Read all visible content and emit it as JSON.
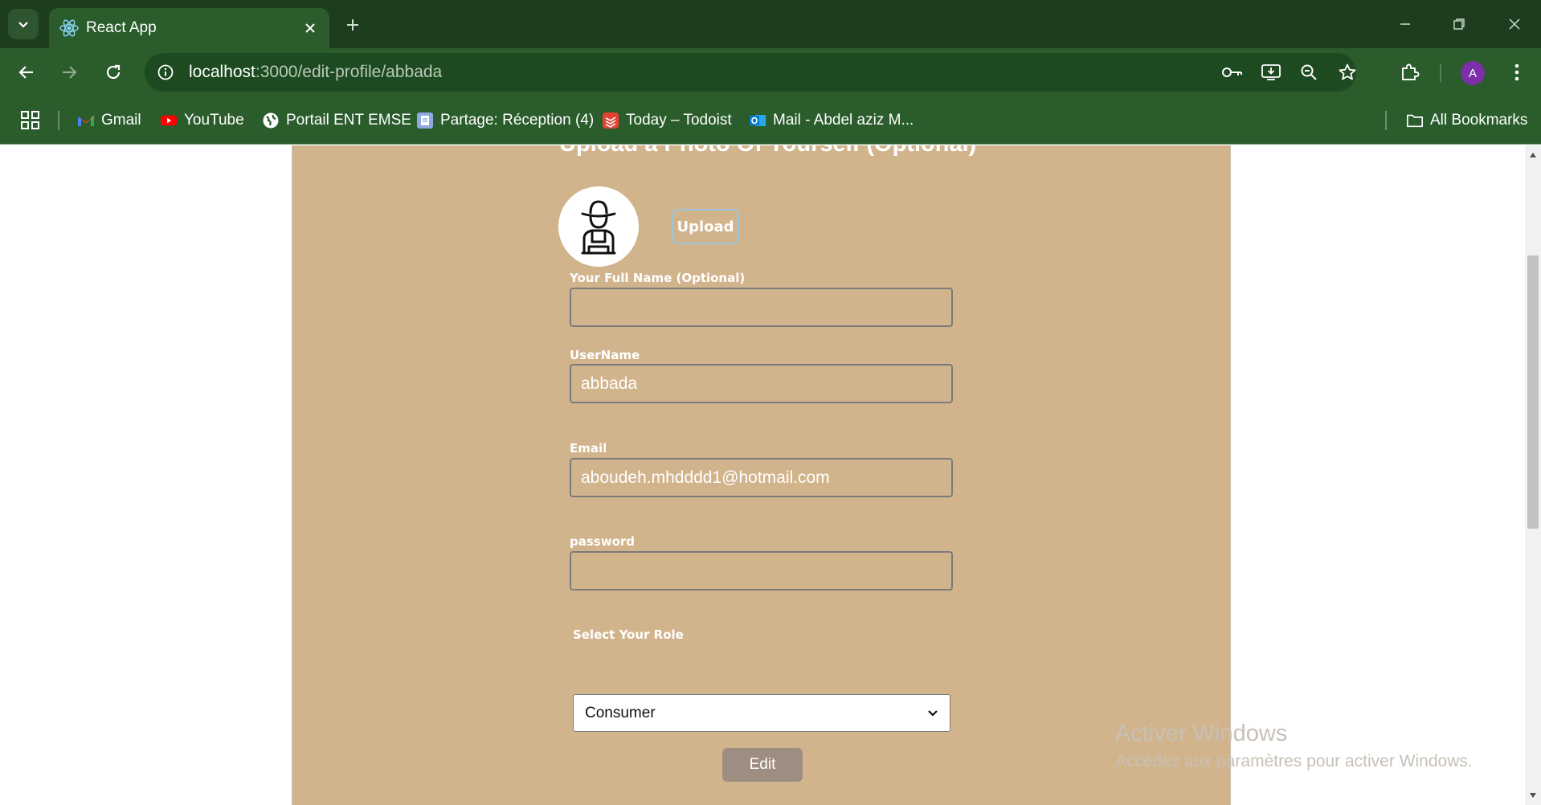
{
  "browser": {
    "tab": {
      "title": "React App"
    },
    "omnibox": {
      "host": "localhost",
      "path": ":3000/edit-profile/abbada"
    },
    "profile_initial": "A",
    "bookmarks": [
      {
        "label": "Gmail",
        "icon": "gmail-icon"
      },
      {
        "label": "YouTube",
        "icon": "youtube-icon"
      },
      {
        "label": "Portail ENT EMSE",
        "icon": "globe-icon"
      },
      {
        "label": "Partage: Réception (4)",
        "icon": "partage-icon"
      },
      {
        "label": "Today – Todoist",
        "icon": "todoist-icon"
      },
      {
        "label": "Mail - Abdel aziz M...",
        "icon": "outlook-icon"
      }
    ],
    "all_bookmarks": "All Bookmarks"
  },
  "page": {
    "title": "Upload a Photo Of Yourself (Optional)",
    "upload_button": "Upload",
    "fields": {
      "fullname": {
        "label": "Your Full Name (Optional)",
        "value": ""
      },
      "username": {
        "label": "UserName",
        "value": "abbada"
      },
      "email": {
        "label": "Email",
        "value": "aboudeh.mhdddd1@hotmail.com"
      },
      "password": {
        "label": "password",
        "value": ""
      }
    },
    "role": {
      "label": "Select Your Role",
      "selected": "Consumer"
    },
    "edit_button": "Edit"
  },
  "watermark": {
    "line1": "Activer Windows",
    "line2": "Accédez aux paramètres pour activer Windows."
  },
  "colors": {
    "chrome_dark": "#1e3d1f",
    "chrome": "#2a5c2c",
    "card": "#d2b48c",
    "edit_button": "#9e8e82",
    "avatar": "#7b2fa8"
  }
}
